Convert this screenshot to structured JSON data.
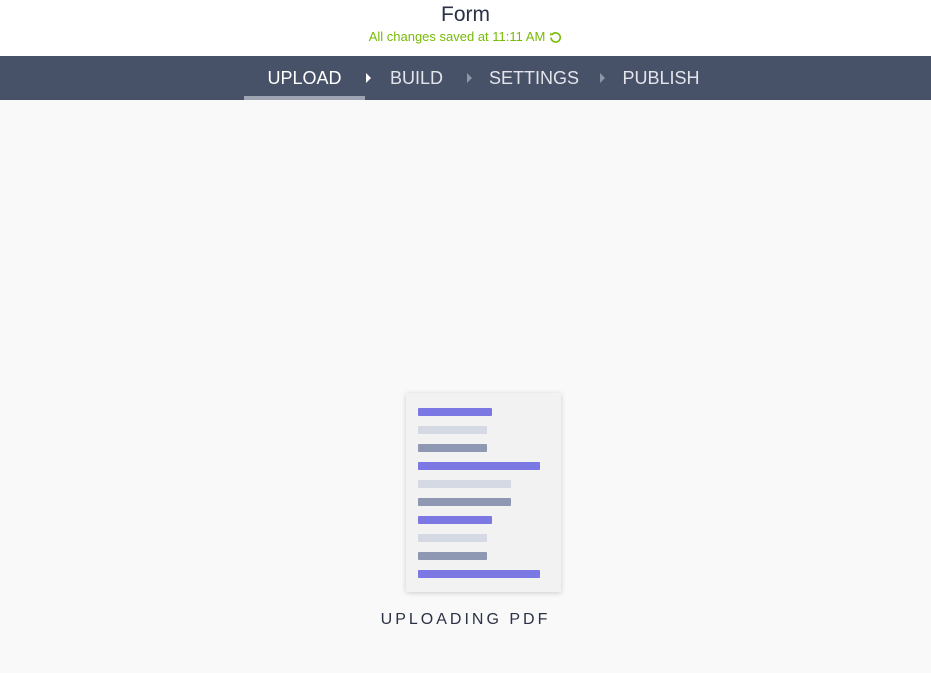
{
  "header": {
    "title": "Form",
    "status": "All changes saved at 11:11 AM",
    "status_icon": "refresh-icon",
    "status_color": "#78bb07"
  },
  "nav": {
    "steps": [
      {
        "label": "UPLOAD",
        "active": true
      },
      {
        "label": "BUILD",
        "active": false
      },
      {
        "label": "SETTINGS",
        "active": false
      },
      {
        "label": "PUBLISH",
        "active": false
      }
    ],
    "background": "#475168"
  },
  "main": {
    "status_text": "UPLOADING PDF",
    "illustration": "pdf-document-icon"
  },
  "colors": {
    "accent": "#7b78e3",
    "page_bg": "#f9f9f9"
  }
}
